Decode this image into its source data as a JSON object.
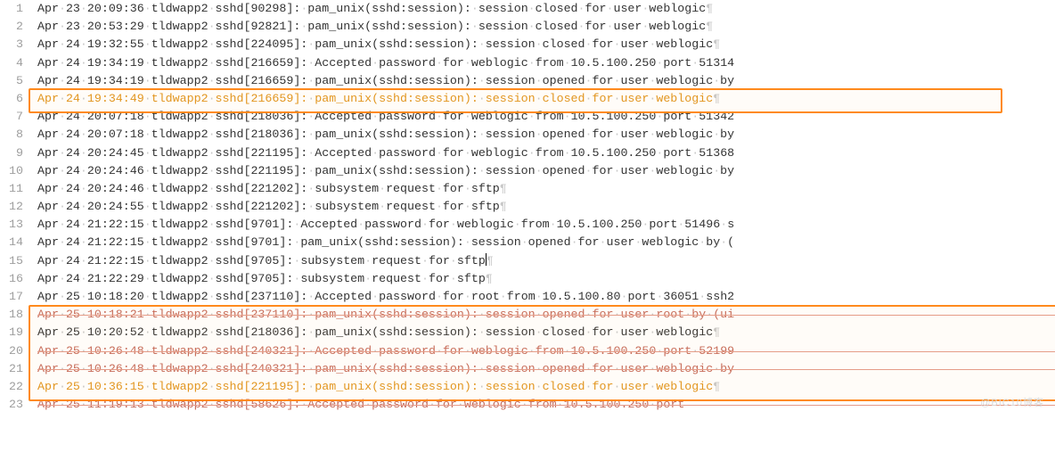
{
  "glyphs": {
    "dot": "·",
    "pilcrow": "¶"
  },
  "watermark": "@BIC10博客",
  "lines": [
    {
      "n": 1,
      "style": "normal",
      "tokens": [
        "Apr",
        "23",
        "20:09:36",
        "tldwapp2",
        "sshd[90298]:",
        "pam_unix(sshd:session):",
        "session",
        "closed",
        "for",
        "user",
        "weblogic"
      ],
      "eol": true
    },
    {
      "n": 2,
      "style": "normal",
      "tokens": [
        "Apr",
        "23",
        "20:53:29",
        "tldwapp2",
        "sshd[92821]:",
        "pam_unix(sshd:session):",
        "session",
        "closed",
        "for",
        "user",
        "weblogic"
      ],
      "eol": true
    },
    {
      "n": 3,
      "style": "normal",
      "tokens": [
        "Apr",
        "24",
        "19:32:55",
        "tldwapp2",
        "sshd[224095]:",
        "pam_unix(sshd:session):",
        "session",
        "closed",
        "for",
        "user",
        "weblogic"
      ],
      "eol": true
    },
    {
      "n": 4,
      "style": "normal",
      "tokens": [
        "Apr",
        "24",
        "19:34:19",
        "tldwapp2",
        "sshd[216659]:",
        "Accepted",
        "password",
        "for",
        "weblogic",
        "from",
        "10.5.100.250",
        "port",
        "51314"
      ],
      "eol": false
    },
    {
      "n": 5,
      "style": "normal",
      "tokens": [
        "Apr",
        "24",
        "19:34:19",
        "tldwapp2",
        "sshd[216659]:",
        "pam_unix(sshd:session):",
        "session",
        "opened",
        "for",
        "user",
        "weblogic",
        "by"
      ],
      "eol": false
    },
    {
      "n": 6,
      "style": "amber",
      "tokens": [
        "Apr",
        "24",
        "19:34:49",
        "tldwapp2",
        "sshd[216659]:",
        "pam_unix(sshd:session):",
        "session",
        "closed",
        "for",
        "user",
        "weblogic"
      ],
      "eol": true
    },
    {
      "n": 7,
      "style": "normal",
      "tokens": [
        "Apr",
        "24",
        "20:07:18",
        "tldwapp2",
        "sshd[218036]:",
        "Accepted",
        "password",
        "for",
        "weblogic",
        "from",
        "10.5.100.250",
        "port",
        "51342"
      ],
      "eol": false
    },
    {
      "n": 8,
      "style": "normal",
      "tokens": [
        "Apr",
        "24",
        "20:07:18",
        "tldwapp2",
        "sshd[218036]:",
        "pam_unix(sshd:session):",
        "session",
        "opened",
        "for",
        "user",
        "weblogic",
        "by"
      ],
      "eol": false
    },
    {
      "n": 9,
      "style": "normal",
      "tokens": [
        "Apr",
        "24",
        "20:24:45",
        "tldwapp2",
        "sshd[221195]:",
        "Accepted",
        "password",
        "for",
        "weblogic",
        "from",
        "10.5.100.250",
        "port",
        "51368"
      ],
      "eol": false
    },
    {
      "n": 10,
      "style": "normal",
      "tokens": [
        "Apr",
        "24",
        "20:24:46",
        "tldwapp2",
        "sshd[221195]:",
        "pam_unix(sshd:session):",
        "session",
        "opened",
        "for",
        "user",
        "weblogic",
        "by"
      ],
      "eol": false
    },
    {
      "n": 11,
      "style": "normal",
      "tokens": [
        "Apr",
        "24",
        "20:24:46",
        "tldwapp2",
        "sshd[221202]:",
        "subsystem",
        "request",
        "for",
        "sftp"
      ],
      "eol": true
    },
    {
      "n": 12,
      "style": "normal",
      "tokens": [
        "Apr",
        "24",
        "20:24:55",
        "tldwapp2",
        "sshd[221202]:",
        "subsystem",
        "request",
        "for",
        "sftp"
      ],
      "eol": true
    },
    {
      "n": 13,
      "style": "normal",
      "tokens": [
        "Apr",
        "24",
        "21:22:15",
        "tldwapp2",
        "sshd[9701]:",
        "Accepted",
        "password",
        "for",
        "weblogic",
        "from",
        "10.5.100.250",
        "port",
        "51496",
        "s"
      ],
      "eol": false
    },
    {
      "n": 14,
      "style": "normal",
      "tokens": [
        "Apr",
        "24",
        "21:22:15",
        "tldwapp2",
        "sshd[9701]:",
        "pam_unix(sshd:session):",
        "session",
        "opened",
        "for",
        "user",
        "weblogic",
        "by",
        "("
      ],
      "eol": false
    },
    {
      "n": 15,
      "style": "normal",
      "tokens": [
        "Apr",
        "24",
        "21:22:15",
        "tldwapp2",
        "sshd[9705]:",
        "subsystem",
        "request",
        "for",
        "sftp"
      ],
      "eol": true,
      "caret": true
    },
    {
      "n": 16,
      "style": "normal",
      "tokens": [
        "Apr",
        "24",
        "21:22:29",
        "tldwapp2",
        "sshd[9705]:",
        "subsystem",
        "request",
        "for",
        "sftp"
      ],
      "eol": true
    },
    {
      "n": 17,
      "style": "normal",
      "tokens": [
        "Apr",
        "25",
        "10:18:20",
        "tldwapp2",
        "sshd[237110]:",
        "Accepted",
        "password",
        "for",
        "root",
        "from",
        "10.5.100.80",
        "port",
        "36051",
        "ssh2"
      ],
      "eol": false
    },
    {
      "n": 18,
      "style": "strike",
      "tokens": [
        "Apr",
        "25",
        "10:18:21",
        "tldwapp2",
        "sshd[237110]:",
        "pam_unix(sshd:session):",
        "session",
        "opened",
        "for",
        "user",
        "root",
        "by",
        "(ui"
      ],
      "eol": false
    },
    {
      "n": 19,
      "style": "normal",
      "tokens": [
        "Apr",
        "25",
        "10:20:52",
        "tldwapp2",
        "sshd[218036]:",
        "pam_unix(sshd:session):",
        "session",
        "closed",
        "for",
        "user",
        "weblogic"
      ],
      "eol": true
    },
    {
      "n": 20,
      "style": "strike",
      "tokens": [
        "Apr",
        "25",
        "10:26:48",
        "tldwapp2",
        "sshd[240321]:",
        "Accepted",
        "password",
        "for",
        "weblogic",
        "from",
        "10.5.100.250",
        "port",
        "52199"
      ],
      "eol": false
    },
    {
      "n": 21,
      "style": "strike",
      "tokens": [
        "Apr",
        "25",
        "10:26:48",
        "tldwapp2",
        "sshd[240321]:",
        "pam_unix(sshd:session):",
        "session",
        "opened",
        "for",
        "user",
        "weblogic",
        "by"
      ],
      "eol": false
    },
    {
      "n": 22,
      "style": "amber",
      "tokens": [
        "Apr",
        "25",
        "10:36:15",
        "tldwapp2",
        "sshd[221195]:",
        "pam_unix(sshd:session):",
        "session",
        "closed",
        "for",
        "user",
        "weblogic"
      ],
      "eol": true
    },
    {
      "n": 23,
      "style": "strike",
      "tokens": [
        "Apr",
        "25",
        "11:19:13",
        "tldwapp2",
        "sshd[58626]:",
        "Accepted",
        "password",
        "for",
        "weblogic",
        "from",
        "10.5.100.250",
        "port"
      ],
      "eol": false
    }
  ]
}
